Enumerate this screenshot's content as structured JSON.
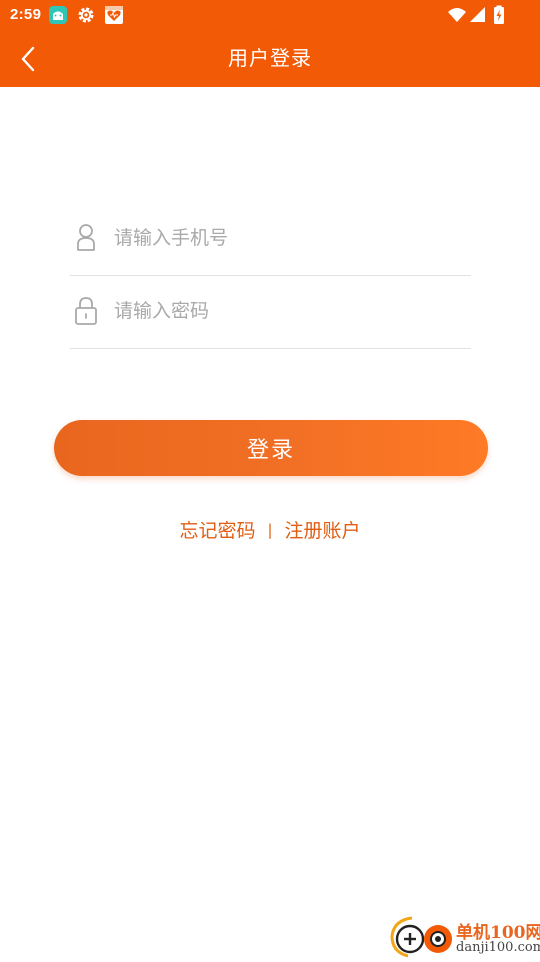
{
  "status_bar": {
    "time": "2:59",
    "icons": [
      "android-car-app-icon",
      "settings-gear-icon",
      "heart-app-icon",
      "wifi-icon",
      "cell-signal-icon",
      "battery-charging-icon"
    ]
  },
  "app_bar": {
    "title": "用户登录",
    "back_icon": "chevron-left-icon"
  },
  "form": {
    "phone": {
      "placeholder": "请输入手机号",
      "value": "",
      "icon": "user-icon"
    },
    "password": {
      "placeholder": "请输入密码",
      "value": "",
      "icon": "lock-icon"
    },
    "login_label": "登录"
  },
  "links": {
    "forgot": "忘记密码",
    "divider": "|",
    "register": "注册账户"
  },
  "watermark": {
    "cn": "单机100网",
    "en": "danji100.com"
  },
  "colors": {
    "primary": "#F25A06",
    "button_start": "#E8661E",
    "button_end": "#FF7A25",
    "link": "#E05E14",
    "placeholder": "#A9A9A9",
    "divider": "#E2E2E2"
  }
}
